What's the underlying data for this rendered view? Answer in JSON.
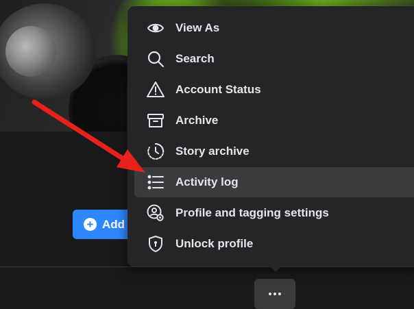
{
  "menu": {
    "items": [
      {
        "label": "View As",
        "icon": "eye-icon"
      },
      {
        "label": "Search",
        "icon": "search-icon"
      },
      {
        "label": "Account Status",
        "icon": "warning-icon"
      },
      {
        "label": "Archive",
        "icon": "archive-icon"
      },
      {
        "label": "Story archive",
        "icon": "story-archive-icon"
      },
      {
        "label": "Activity log",
        "icon": "list-icon",
        "highlighted": true
      },
      {
        "label": "Profile and tagging settings",
        "icon": "profile-settings-icon"
      },
      {
        "label": "Unlock profile",
        "icon": "shield-lock-icon"
      }
    ]
  },
  "profile": {
    "add_button_label": "Add",
    "add_button_icon": "plus-circle-icon",
    "more_button_icon": "more-dots-icon"
  },
  "annotation": {
    "arrow_color": "#e8221b",
    "points_to": "Activity log"
  },
  "colors": {
    "background": "#18191a",
    "menu_bg": "#242526",
    "highlight_bg": "#3a3b3c",
    "text": "#e4e6eb",
    "primary": "#2d88ff"
  }
}
